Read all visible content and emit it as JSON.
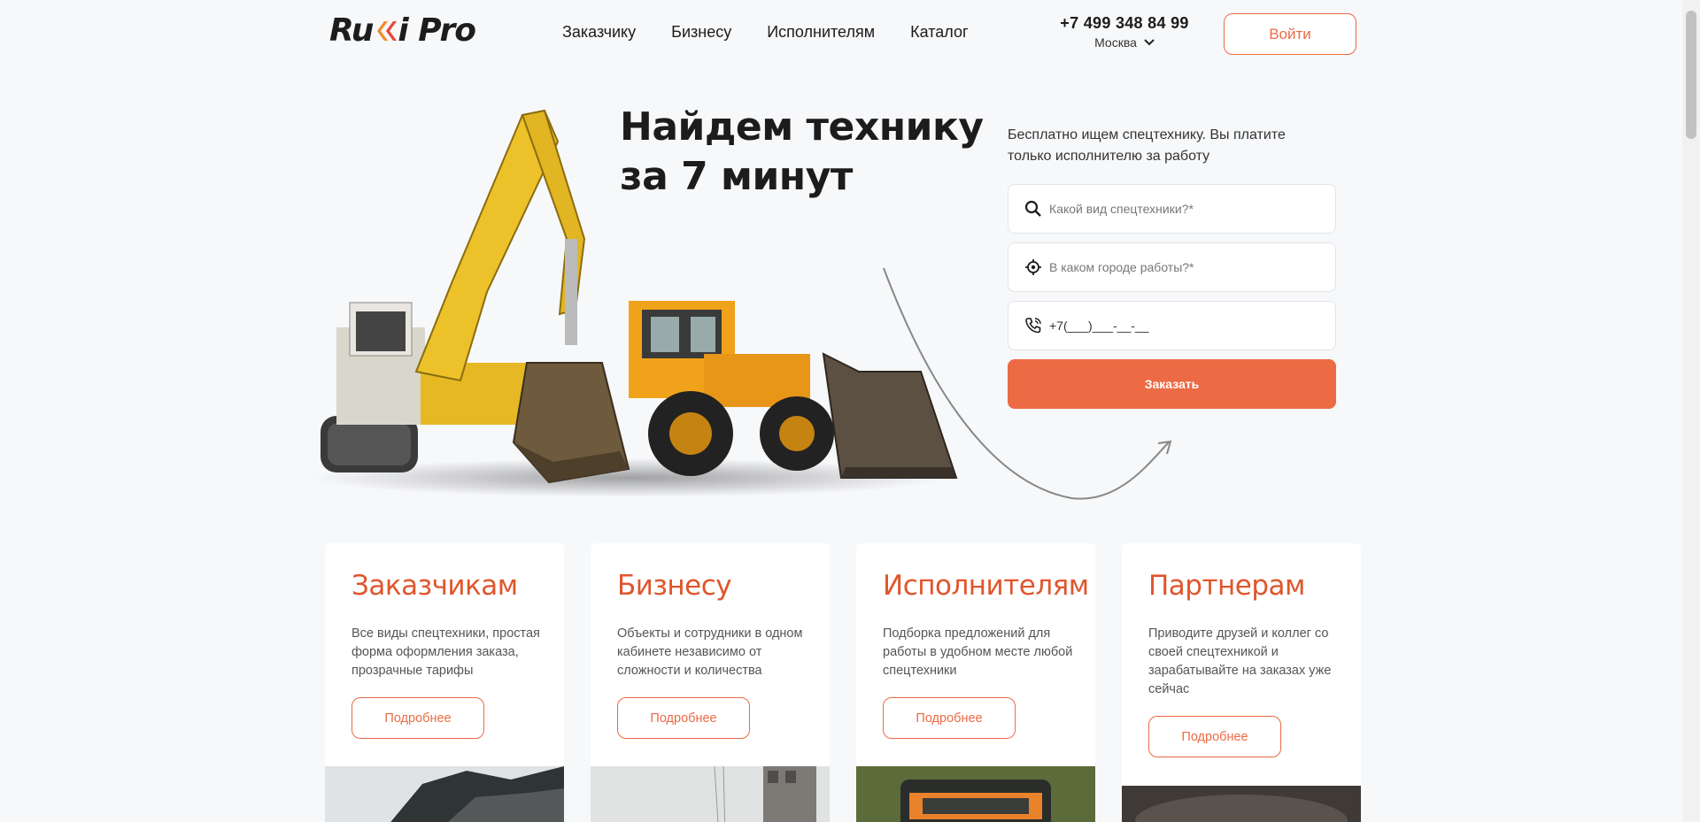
{
  "header": {
    "logo": "Rukki Pro",
    "nav": [
      "Заказчику",
      "Бизнесу",
      "Исполнителям",
      "Каталог"
    ],
    "phone": "+7 499 348 84 99",
    "city": "Москва",
    "login": "Войти"
  },
  "hero": {
    "title_line1": "Найдем технику",
    "title_line2": "за 7 минут",
    "subtitle": "Бесплатно ищем спецтехнику. Вы платите только исполнителю за работу"
  },
  "form": {
    "type_placeholder": "Какой вид спецтехники?*",
    "city_placeholder": "В каком городе работы?*",
    "phone_value": "+7(___)___-__-__",
    "submit": "Заказать"
  },
  "cards": [
    {
      "title": "Заказчикам",
      "text": "Все виды спецтехники, простая форма оформления заказа, прозрачные тарифы",
      "button": "Подробнее"
    },
    {
      "title": "Бизнесу",
      "text": "Объекты и сотрудники в одном кабинете независимо от сложности и количества",
      "button": "Подробнее"
    },
    {
      "title": "Исполнителям",
      "text": "Подборка предложений для работы в удобном месте любой спецтехники",
      "button": "Подробнее"
    },
    {
      "title": "Партнерам",
      "text": "Приводите друзей и коллег со своей спецтехникой и зарабатывайте на заказах уже сейчас",
      "button": "Подробнее"
    }
  ],
  "colors": {
    "accent": "#ec6a44",
    "heading_accent": "#e0562d",
    "background": "#f7f8fa"
  },
  "icons": [
    "search-icon",
    "location-icon",
    "phone-icon",
    "chevron-down-icon"
  ]
}
